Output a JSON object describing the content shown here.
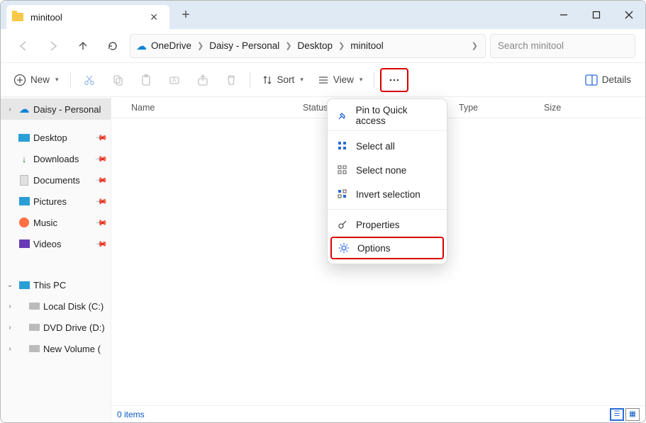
{
  "tab": {
    "title": "minitool"
  },
  "breadcrumbs": {
    "root_label": "OneDrive",
    "items": [
      "Daisy - Personal",
      "Desktop",
      "minitool"
    ]
  },
  "search": {
    "placeholder": "Search minitool"
  },
  "toolbar": {
    "new_label": "New",
    "sort_label": "Sort",
    "view_label": "View",
    "details_label": "Details"
  },
  "columns": {
    "name": "Name",
    "status": "Status",
    "type": "Type",
    "size": "Size"
  },
  "sidebar": {
    "top": "Daisy - Personal",
    "quick": [
      {
        "label": "Desktop"
      },
      {
        "label": "Downloads"
      },
      {
        "label": "Documents"
      },
      {
        "label": "Pictures"
      },
      {
        "label": "Music"
      },
      {
        "label": "Videos"
      }
    ],
    "pc_label": "This PC",
    "drives": [
      {
        "label": "Local Disk (C:)"
      },
      {
        "label": "DVD Drive (D:)"
      },
      {
        "label": "New Volume ("
      }
    ]
  },
  "context_menu": {
    "pin": "Pin to Quick access",
    "select_all": "Select all",
    "select_none": "Select none",
    "invert": "Invert selection",
    "properties": "Properties",
    "options": "Options"
  },
  "status": {
    "count": "0 items"
  }
}
